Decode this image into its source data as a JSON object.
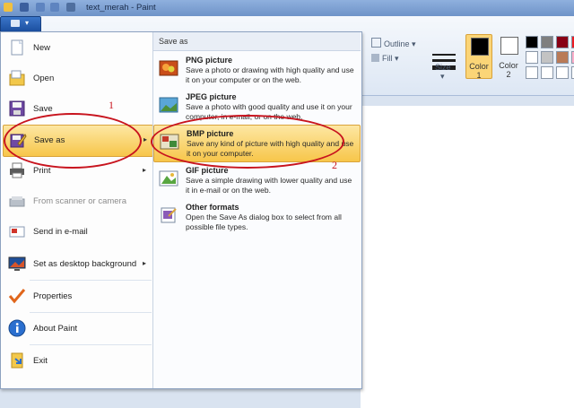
{
  "window": {
    "title": "text_merah - Paint"
  },
  "ribbon": {
    "outline_label": "Outline",
    "fill_label": "Fill",
    "size_label": "Size",
    "color1_label": "Color 1",
    "color2_label": "Color 2",
    "color1_value": "#000000",
    "color2_value": "#ffffff",
    "palette": [
      "#000000",
      "#7f7f7f",
      "#880015",
      "#ed1c24",
      "#ffffff",
      "#c3c3c3",
      "#b97a57",
      "#ffaec9",
      "#ffffff",
      "#ffffff",
      "#ffffff",
      "#ffffff"
    ]
  },
  "file_menu": {
    "items": [
      {
        "label": "New",
        "icon": "new-icon"
      },
      {
        "label": "Open",
        "icon": "open-folder-icon"
      },
      {
        "label": "Save",
        "icon": "floppy-icon"
      },
      {
        "label": "Save as",
        "icon": "save-as-icon",
        "has_submenu": true,
        "active": true
      },
      {
        "label": "Print",
        "icon": "printer-icon",
        "has_submenu": true
      },
      {
        "label": "From scanner or camera",
        "icon": "scanner-icon",
        "disabled": true
      },
      {
        "label": "Send in e-mail",
        "icon": "email-icon"
      },
      {
        "label": "Set as desktop background",
        "icon": "desktop-icon",
        "has_submenu": true
      },
      {
        "label": "Properties",
        "icon": "checkmark-icon"
      },
      {
        "label": "About Paint",
        "icon": "info-icon"
      },
      {
        "label": "Exit",
        "icon": "exit-icon"
      }
    ]
  },
  "save_as_submenu": {
    "header": "Save as",
    "items": [
      {
        "title": "PNG picture",
        "description": "Save a photo or drawing with high quality and use it on your computer or on the web."
      },
      {
        "title": "JPEG picture",
        "description": "Save a photo with good quality and use it on your computer, in e-mail, or on the web."
      },
      {
        "title": "BMP picture",
        "description": "Save any kind of picture with high quality and use it on your computer.",
        "active": true
      },
      {
        "title": "GIF picture",
        "description": "Save a simple drawing with lower quality and use it in e-mail or on the web."
      },
      {
        "title": "Other formats",
        "description": "Open the Save As dialog box to select from all possible file types."
      }
    ]
  },
  "annotations": {
    "label_1": "1",
    "label_2": "2",
    "color": "#c8141e"
  }
}
